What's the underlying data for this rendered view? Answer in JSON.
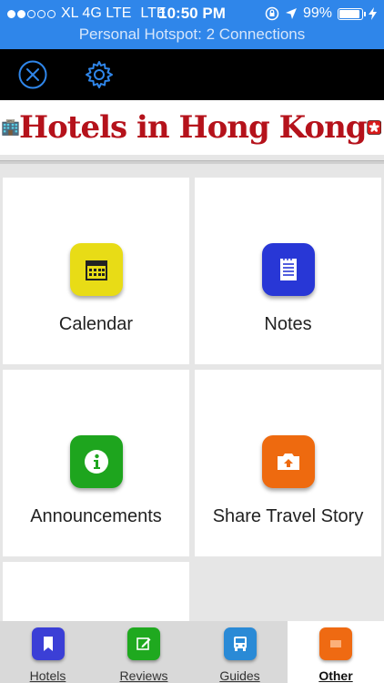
{
  "status_bar": {
    "carrier": "XL 4G LTE",
    "network": "LTE",
    "time": "10:50 PM",
    "battery": "99%",
    "hotspot": "Personal Hotspot: 2 Connections"
  },
  "toolbar": {
    "close_icon": "close-circle-icon",
    "settings_icon": "gear-icon"
  },
  "banner": {
    "title": "Hotels in Hong Kong"
  },
  "tiles": [
    {
      "label": "Calendar",
      "icon": "calendar-icon",
      "color": "#e8dc16"
    },
    {
      "label": "Notes",
      "icon": "notes-icon",
      "color": "#2837d6"
    },
    {
      "label": "Announcements",
      "icon": "info-icon",
      "color": "#1ea51e"
    },
    {
      "label": "Share Travel Story",
      "icon": "camera-icon",
      "color": "#ee6a0f"
    }
  ],
  "tabs": [
    {
      "label": "Hotels",
      "color": "#3b3fd6",
      "active": false
    },
    {
      "label": "Reviews",
      "color": "#1fa91f",
      "active": false
    },
    {
      "label": "Guides",
      "color": "#2a8ad6",
      "active": false
    },
    {
      "label": "Other",
      "color": "#ef6a12",
      "active": true
    }
  ],
  "colors": {
    "status_bar": "#2f86ea",
    "toolbar": "#000000",
    "accent_icon": "#2f86ea",
    "banner_text": "#b5121b"
  }
}
